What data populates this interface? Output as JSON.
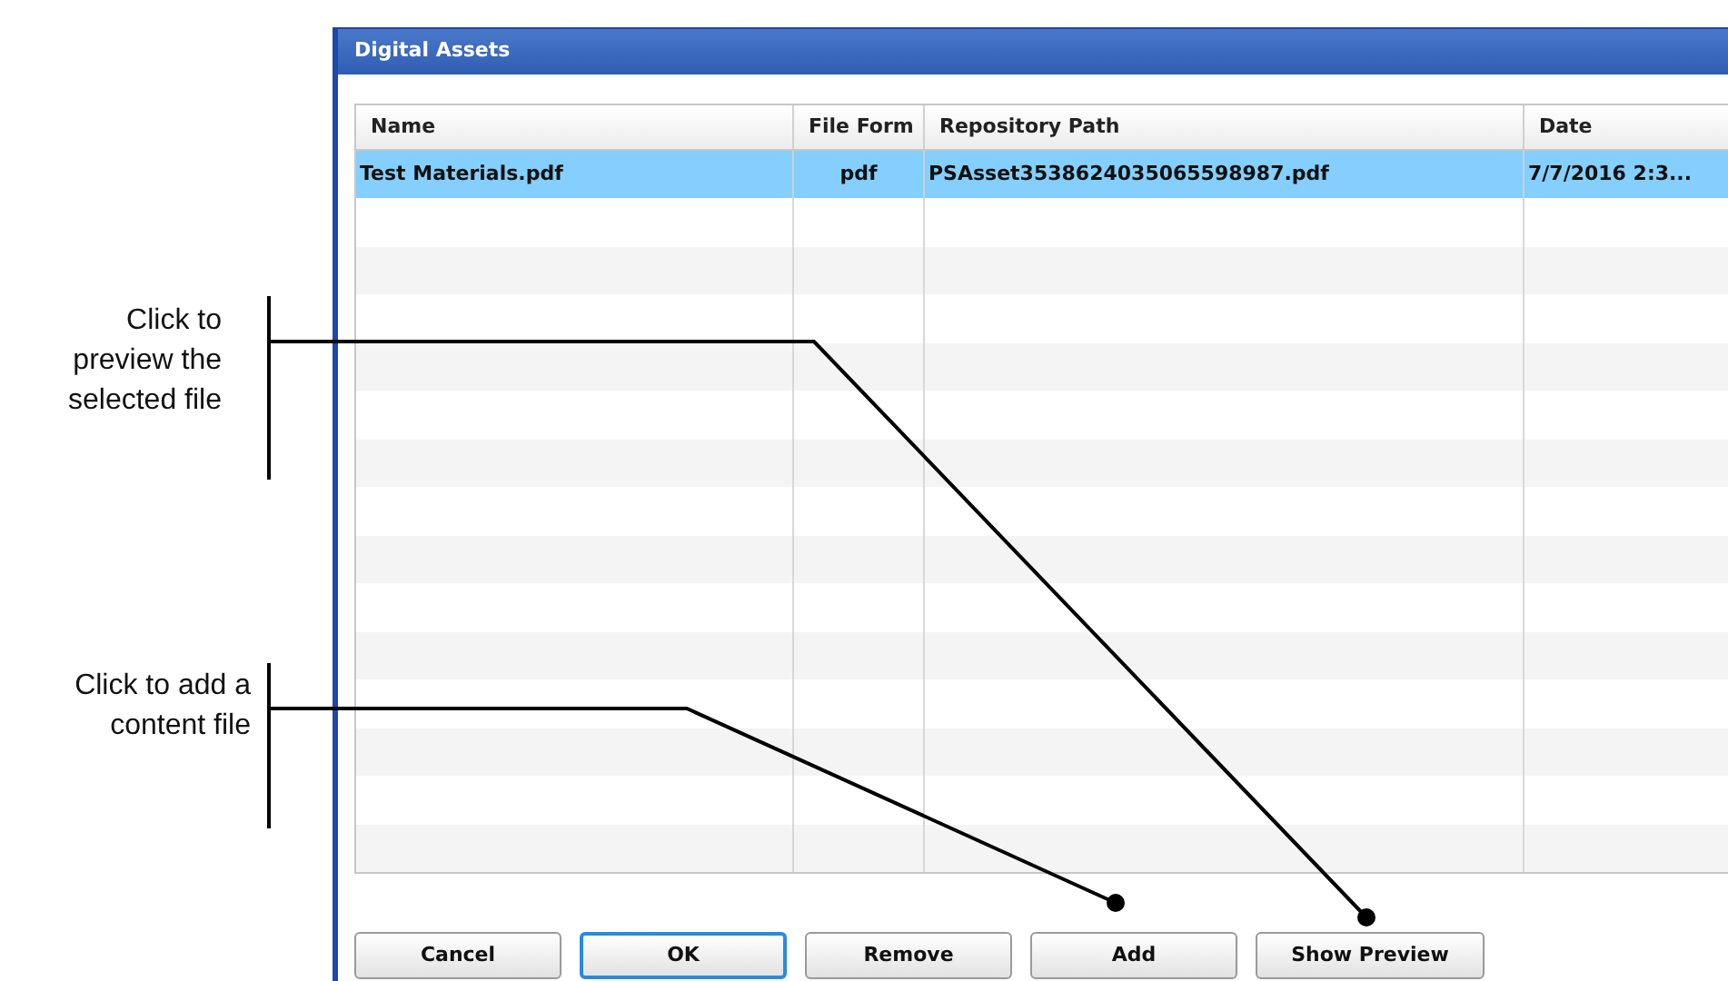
{
  "callouts": [
    {
      "text": "Click to preview the selected file"
    },
    {
      "text": "Click to add a content file"
    }
  ],
  "window": {
    "title": "Digital Assets"
  },
  "table": {
    "columns": [
      "Name",
      "File Form",
      "Repository Path",
      "Date"
    ],
    "rows": [
      {
        "cells": [
          "Test Materials.pdf",
          "pdf",
          "PSAsset3538624035065598987.pdf",
          "7/7/2016 2:3..."
        ],
        "selected": true
      }
    ]
  },
  "buttons": [
    {
      "label": "Cancel",
      "focused": false
    },
    {
      "label": "OK",
      "focused": true
    },
    {
      "label": "Remove",
      "focused": false
    },
    {
      "label": "Add",
      "focused": false
    },
    {
      "label": "Show Preview",
      "focused": false
    }
  ]
}
